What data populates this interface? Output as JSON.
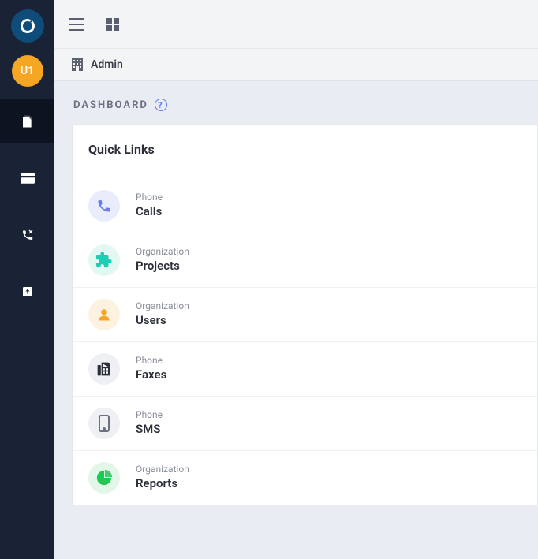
{
  "sidebar": {
    "avatar_text": "U1",
    "nav": [
      {
        "name": "pages",
        "active": true
      },
      {
        "name": "billing",
        "active": false
      },
      {
        "name": "phone",
        "active": false
      },
      {
        "name": "archive",
        "active": false
      }
    ]
  },
  "breadcrumb": {
    "label": "Admin"
  },
  "page_title": "DASHBOARD",
  "quick_links": {
    "title": "Quick Links",
    "items": [
      {
        "category": "Phone",
        "label": "Calls",
        "icon": "phone",
        "icon_color": "#6a7cf2",
        "bg": "#e9ecfb"
      },
      {
        "category": "Organization",
        "label": "Projects",
        "icon": "puzzle",
        "icon_color": "#1ccfb4",
        "bg": "#e3f7f3"
      },
      {
        "category": "Organization",
        "label": "Users",
        "icon": "user",
        "icon_color": "#f5a623",
        "bg": "#fdf2df"
      },
      {
        "category": "Phone",
        "label": "Faxes",
        "icon": "fax",
        "icon_color": "#2b2f3a",
        "bg": "#eef0f4"
      },
      {
        "category": "Phone",
        "label": "SMS",
        "icon": "mobile",
        "icon_color": "#6c7280",
        "bg": "#eef0f4"
      },
      {
        "category": "Organization",
        "label": "Reports",
        "icon": "pie",
        "icon_color": "#23c653",
        "bg": "#e3f7e8"
      }
    ]
  }
}
